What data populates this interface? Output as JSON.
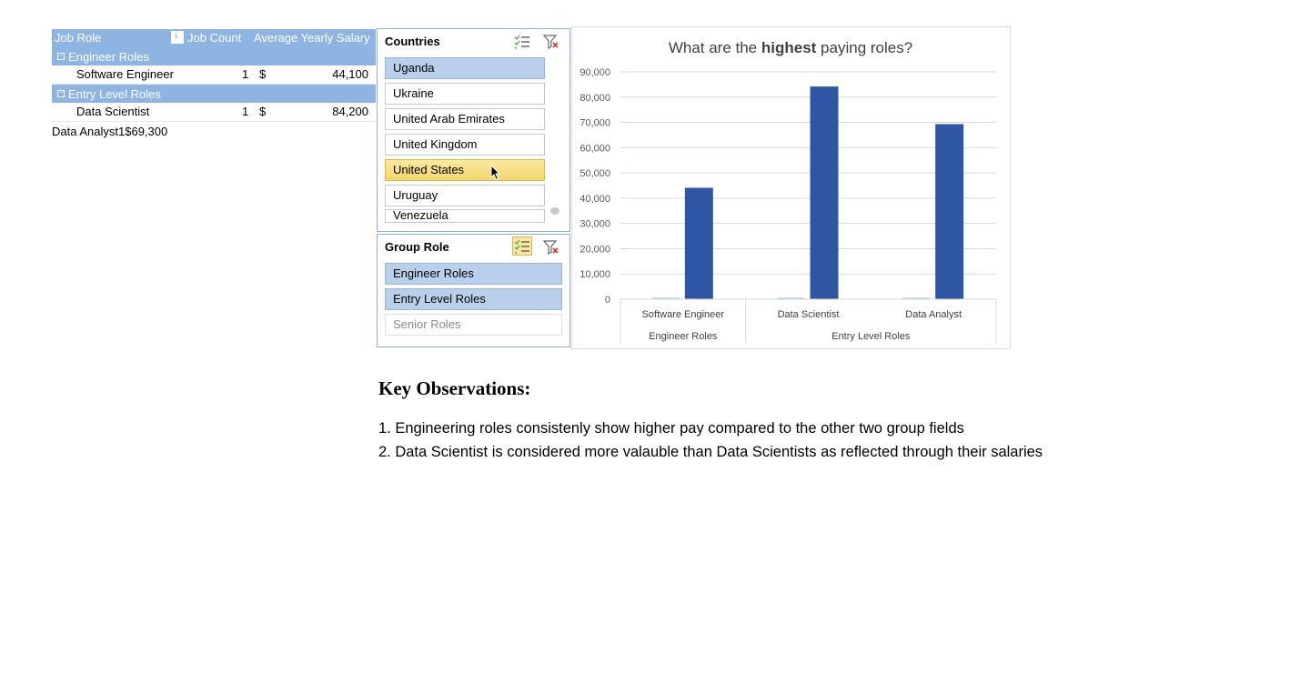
{
  "pivot": {
    "headers": {
      "job_role": "Job Role",
      "job_count": "Job Count",
      "avg_salary": "Average Yearly Salary"
    },
    "groups": [
      {
        "name": "Engineer Roles",
        "items": [
          {
            "role": "Software Engineer",
            "count": "1",
            "currency": "$",
            "salary": "44,100"
          }
        ]
      },
      {
        "name": "Entry Level Roles",
        "items": [
          {
            "role": "Data Scientist",
            "count": "1",
            "currency": "$",
            "salary": "84,200"
          },
          {
            "role": "Data Analyst",
            "count": "1",
            "currency": "$",
            "salary": "69,300"
          }
        ]
      }
    ]
  },
  "countries_slicer": {
    "title": "Countries",
    "items": [
      {
        "label": "Uganda",
        "state": "selected"
      },
      {
        "label": "Ukraine",
        "state": "normal"
      },
      {
        "label": "United Arab Emirates",
        "state": "normal"
      },
      {
        "label": "United Kingdom",
        "state": "normal"
      },
      {
        "label": "United States",
        "state": "hover"
      },
      {
        "label": "Uruguay",
        "state": "normal"
      },
      {
        "label": "Venezuela",
        "state": "normal"
      }
    ]
  },
  "group_role_slicer": {
    "title": "Group Role",
    "items": [
      {
        "label": "Engineer Roles",
        "state": "selected"
      },
      {
        "label": "Entry Level Roles",
        "state": "selected"
      },
      {
        "label": "Senior Roles",
        "state": "dim"
      }
    ]
  },
  "chart_data": {
    "type": "bar",
    "title_parts": [
      "What are the ",
      "highest",
      " paying roles?"
    ],
    "categories": [
      "Software Engineer",
      "Data Scientist",
      "Data Analyst"
    ],
    "groups": [
      {
        "name": "Engineer Roles",
        "span": 1
      },
      {
        "name": "Entry Level Roles",
        "span": 2
      }
    ],
    "series": [
      {
        "values": [
          44100,
          84200,
          69300
        ],
        "color": "#2f56a3"
      }
    ],
    "ylim": [
      0,
      90000
    ],
    "yticks": [
      "0",
      "10,000",
      "20,000",
      "30,000",
      "40,000",
      "50,000",
      "60,000",
      "70,000",
      "80,000",
      "90,000"
    ],
    "grid": true,
    "gridline_color": "#d9d9d9"
  },
  "observations": {
    "title": "Key Observations:",
    "lines": [
      "1. Engineering roles consistenly show higher pay compared to the other two group fields",
      "2. Data Scientist is considered more valauble than Data Scientists as reflected through their salaries"
    ]
  },
  "colors": {
    "accent": "#8db4e2",
    "bar": "#2f56a3",
    "slicer_selected": "#b8d0ec",
    "slicer_hover": "#f5d66a"
  }
}
